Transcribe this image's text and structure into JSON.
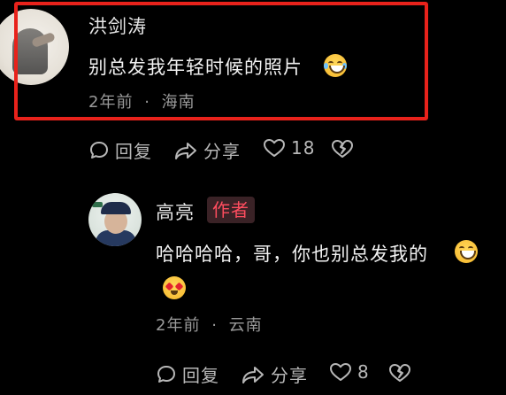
{
  "comments": [
    {
      "username": "洪剑涛",
      "text": "别总发我年轻时候的照片",
      "emoji": "laugh-cry-emoji",
      "time": "2年前",
      "separator": "·",
      "location": "海南",
      "actions": {
        "reply": "回复",
        "share": "分享",
        "likes": "18"
      }
    },
    {
      "username": "高亮",
      "author_tag": "作者",
      "text": "哈哈哈哈，哥，你也别总发我的",
      "emojis": [
        "grin-emoji",
        "heart-eyes-emoji"
      ],
      "time": "2年前",
      "separator": "·",
      "location": "云南",
      "actions": {
        "reply": "回复",
        "share": "分享",
        "likes": "8"
      }
    }
  ],
  "colors": {
    "highlight_border": "#e8221b",
    "author_tag_text": "#ff4d5f",
    "author_tag_bg": "#3a2226"
  }
}
